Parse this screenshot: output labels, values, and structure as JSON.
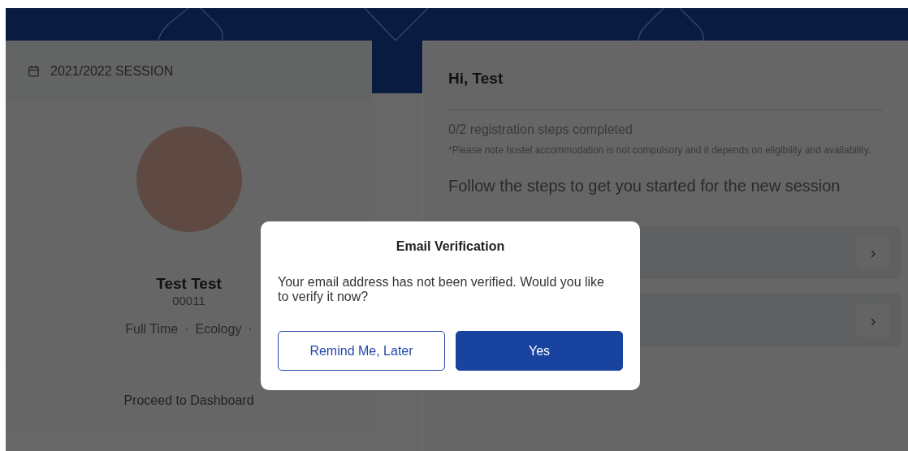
{
  "session": {
    "label": "2021/2022 SESSION"
  },
  "profile": {
    "name": "Test Test",
    "id": "00011",
    "meta": [
      "Full Time",
      "·",
      "Ecology",
      "·"
    ]
  },
  "proceed": {
    "label": "Proceed to Dashboard"
  },
  "main": {
    "greeting": "Hi, Test",
    "progress": {
      "text": "0/2 registration steps completed"
    },
    "note": "*Please note hostel accommodation is not compulsory and it depends on eligibility and availability.",
    "heading": "Follow the steps to get you started for the new session",
    "steps": [
      {
        "chevron": "›"
      },
      {
        "chevron": "›"
      }
    ]
  },
  "dialog": {
    "title": "Email Verification",
    "message": "Your email address has not been verified. Would you like to verify it now?",
    "buttons": [
      {
        "label": "Remind Me, Later",
        "kind": "secondary"
      },
      {
        "label": "Yes",
        "kind": "primary"
      }
    ]
  }
}
